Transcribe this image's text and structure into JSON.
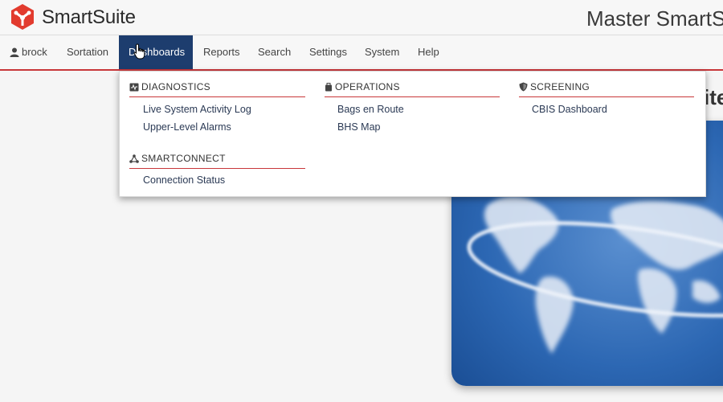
{
  "header": {
    "brand": "SmartSuite",
    "site_title": "Master SmartSu",
    "logo_color": "#e23b2e"
  },
  "nav": {
    "user": {
      "icon": "user-icon",
      "label": "brock"
    },
    "items": [
      {
        "label": "Sortation"
      },
      {
        "label": "Dashboards",
        "active": true
      },
      {
        "label": "Reports"
      },
      {
        "label": "Search"
      },
      {
        "label": "Settings"
      },
      {
        "label": "System"
      },
      {
        "label": "Help"
      }
    ],
    "active_color": "#1d3d6e",
    "underline_color": "#c8373a"
  },
  "dropdown": {
    "sections": [
      {
        "icon": "monitor-icon",
        "title": "DIAGNOSTICS",
        "links": [
          "Live System Activity Log",
          "Upper-Level Alarms"
        ]
      },
      {
        "icon": "network-icon",
        "title": "SMARTCONNECT",
        "links": [
          "Connection Status"
        ]
      },
      {
        "icon": "suitcase-icon",
        "title": "OPERATIONS",
        "links": [
          "Bags en Route",
          "BHS Map"
        ]
      },
      {
        "icon": "shield-icon",
        "title": "SCREENING",
        "links": [
          "CBIS Dashboard"
        ]
      }
    ]
  },
  "main": {
    "partial_heading": "ite"
  }
}
